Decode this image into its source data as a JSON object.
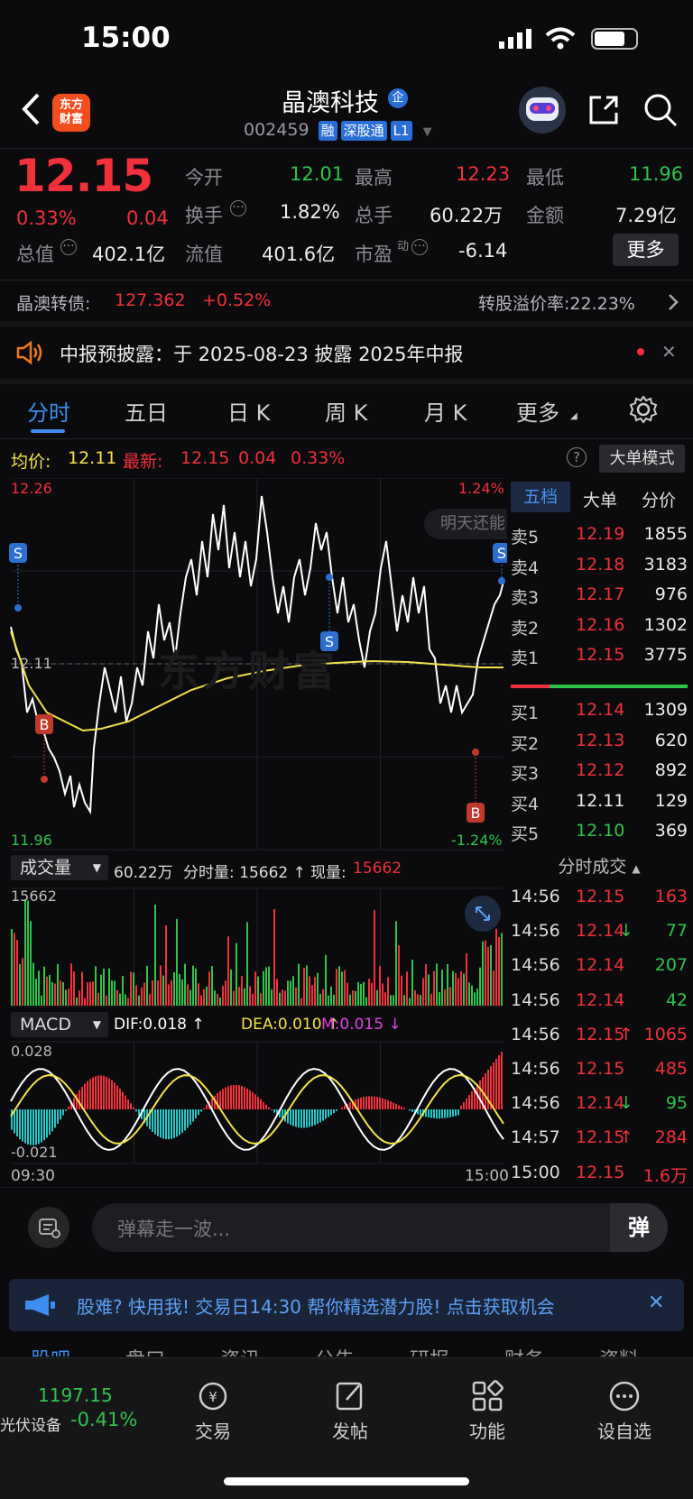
{
  "status": {
    "time": "15:00"
  },
  "header": {
    "stock_name": "晶澳科技",
    "name_badge": "企",
    "stock_code": "002459",
    "tags": [
      "融",
      "深股通",
      "L1"
    ],
    "logo_line1": "东方",
    "logo_line2": "财富"
  },
  "quote": {
    "price": "12.15",
    "change_pct": "0.33%",
    "change_amt": "0.04",
    "open_label": "今开",
    "open": "12.01",
    "high_label": "最高",
    "high": "12.23",
    "low_label": "最低",
    "low": "11.96",
    "turnover_label": "换手",
    "turnover": "1.82%",
    "volume_label": "总手",
    "volume": "60.22万",
    "amount_label": "金额",
    "amount": "7.29亿",
    "mktcap_label": "总值",
    "mktcap": "402.1亿",
    "float_label": "流值",
    "float": "401.6亿",
    "pe_label": "市盈",
    "pe_sup": "动",
    "pe": "-6.14",
    "more_label": "更多"
  },
  "bond": {
    "label": "晶澳转债:",
    "price": "127.362",
    "change": "+0.52%",
    "premium": "转股溢价率:22.23%"
  },
  "notice": {
    "text": "中报预披露：于 2025-08-23 披露 2025年中报"
  },
  "tabs": [
    "分时",
    "五日",
    "日 K",
    "周 K",
    "月 K",
    "更多"
  ],
  "chart_info": {
    "avg_label": "均价:",
    "avg": "12.11",
    "latest_label": "最新:",
    "latest": "12.15",
    "latest_chg": "0.04",
    "latest_pct": "0.33%",
    "big_order_mode": "大单模式",
    "price_top": "12.26",
    "price_mid": "12.11",
    "price_bottom": "11.96",
    "pct_top": "1.24%",
    "pct_bottom": "-1.24%",
    "tip": "明天还能",
    "watermark": "东方财富"
  },
  "orderbook": {
    "tabs": [
      "五档",
      "大单",
      "分价"
    ],
    "asks": [
      {
        "label": "卖5",
        "price": "12.19",
        "vol": "1855"
      },
      {
        "label": "卖4",
        "price": "12.18",
        "vol": "3183"
      },
      {
        "label": "卖3",
        "price": "12.17",
        "vol": "976"
      },
      {
        "label": "卖2",
        "price": "12.16",
        "vol": "1302"
      },
      {
        "label": "卖1",
        "price": "12.15",
        "vol": "3775"
      }
    ],
    "bids": [
      {
        "label": "买1",
        "price": "12.14",
        "vol": "1309"
      },
      {
        "label": "买2",
        "price": "12.13",
        "vol": "620"
      },
      {
        "label": "买3",
        "price": "12.12",
        "vol": "892"
      },
      {
        "label": "买4",
        "price": "12.11",
        "vol": "129"
      },
      {
        "label": "买5",
        "price": "12.10",
        "vol": "369"
      }
    ],
    "trades_header": "分时成交",
    "trades": [
      {
        "time": "14:56",
        "price": "12.15",
        "vol": "163",
        "arrow": "",
        "pc": "red",
        "vc": "red"
      },
      {
        "time": "14:56",
        "price": "12.14",
        "vol": "77",
        "arrow": "↓",
        "pc": "red",
        "vc": "green"
      },
      {
        "time": "14:56",
        "price": "12.14",
        "vol": "207",
        "arrow": "",
        "pc": "red",
        "vc": "green"
      },
      {
        "time": "14:56",
        "price": "12.14",
        "vol": "42",
        "arrow": "",
        "pc": "red",
        "vc": "green"
      },
      {
        "time": "14:56",
        "price": "12.15",
        "vol": "1065",
        "arrow": "↑",
        "pc": "red",
        "vc": "red"
      },
      {
        "time": "14:56",
        "price": "12.15",
        "vol": "485",
        "arrow": "",
        "pc": "red",
        "vc": "red"
      },
      {
        "time": "14:56",
        "price": "12.14",
        "vol": "95",
        "arrow": "↓",
        "pc": "red",
        "vc": "green"
      },
      {
        "time": "14:57",
        "price": "12.15",
        "vol": "284",
        "arrow": "↑",
        "pc": "red",
        "vc": "red"
      },
      {
        "time": "15:00",
        "price": "12.15",
        "vol": "1.6万",
        "arrow": "",
        "pc": "red",
        "vc": "red"
      }
    ]
  },
  "volume": {
    "selector": "成交量",
    "total": "60.22万",
    "minute_label": "分时量: 15662 ↑",
    "now_label": "现量:",
    "now": "15662",
    "axis_max": "15662"
  },
  "macd": {
    "selector": "MACD",
    "dif": "DIF:0.018 ↑",
    "dea": "DEA:0.010 ↑",
    "m": "M:0.015 ↓",
    "axis_top": "0.028",
    "axis_bottom": "-0.021",
    "time_start": "09:30",
    "time_end": "15:00"
  },
  "comment": {
    "placeholder": "弹幕走一波...",
    "send": "弹"
  },
  "banner": {
    "text": "股难? 快用我! 交易日14:30 帮你精选潜力股! 点击获取机会"
  },
  "index": {
    "value": "1197.15",
    "name": "光伏设备",
    "pct": "-0.41%"
  },
  "nav": [
    "交易",
    "发帖",
    "功能",
    "设自选"
  ],
  "subtabs": [
    "股吧",
    "盘口",
    "资讯",
    "公告",
    "研报",
    "财务",
    "资料"
  ],
  "colors": {
    "up": "#f0303a",
    "down": "#2fc34b",
    "price_line": "#ffffff",
    "avg_line": "#f2e24a",
    "accent": "#2a6fd6"
  }
}
